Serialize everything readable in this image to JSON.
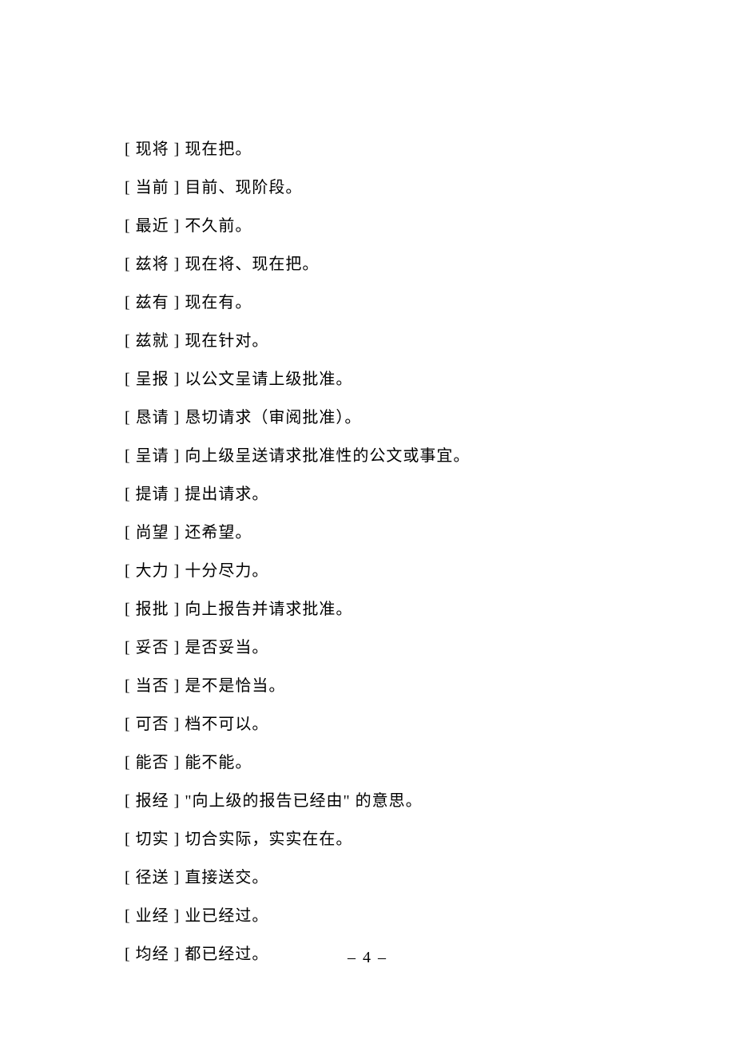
{
  "entries": [
    {
      "term": "[ 现将 ]",
      "definition": " 现在把。"
    },
    {
      "term": "[ 当前 ]",
      "definition": " 目前、现阶段。"
    },
    {
      "term": "[ 最近 ]",
      "definition": " 不久前。"
    },
    {
      "term": "[ 兹将 ]",
      "definition": " 现在将、现在把。"
    },
    {
      "term": "[ 兹有 ]",
      "definition": " 现在有。"
    },
    {
      "term": "[ 兹就 ]",
      "definition": " 现在针对。"
    },
    {
      "term": "[ 呈报 ]",
      "definition": " 以公文呈请上级批准。"
    },
    {
      "term": "[ 恳请 ]",
      "definition": " 恳切请求（审阅批准）。"
    },
    {
      "term": "[ 呈请 ]",
      "definition": " 向上级呈送请求批准性的公文或事宜。"
    },
    {
      "term": "[ 提请 ]",
      "definition": " 提出请求。"
    },
    {
      "term": "[ 尚望 ]",
      "definition": " 还希望。"
    },
    {
      "term": "[ 大力 ]",
      "definition": " 十分尽力。"
    },
    {
      "term": "[ 报批 ]",
      "definition": " 向上报告并请求批准。"
    },
    {
      "term": "[ 妥否 ]",
      "definition": " 是否妥当。"
    },
    {
      "term": "[ 当否 ]",
      "definition": " 是不是恰当。"
    },
    {
      "term": "[ 可否 ]",
      "definition": " 档不可以。"
    },
    {
      "term": "[ 能否 ]",
      "definition": " 能不能。"
    },
    {
      "term": "[ 报经 ]",
      "definition": " \"向上级的报告已经由\" 的意思。"
    },
    {
      "term": "[ 切实 ]",
      "definition": " 切合实际，实实在在。"
    },
    {
      "term": "[ 径送 ]",
      "definition": " 直接送交。"
    },
    {
      "term": "[ 业经 ]",
      "definition": " 业已经过。"
    },
    {
      "term": "[ 均经 ]",
      "definition": " 都已经过。"
    }
  ],
  "pageNumber": "– 4 –"
}
